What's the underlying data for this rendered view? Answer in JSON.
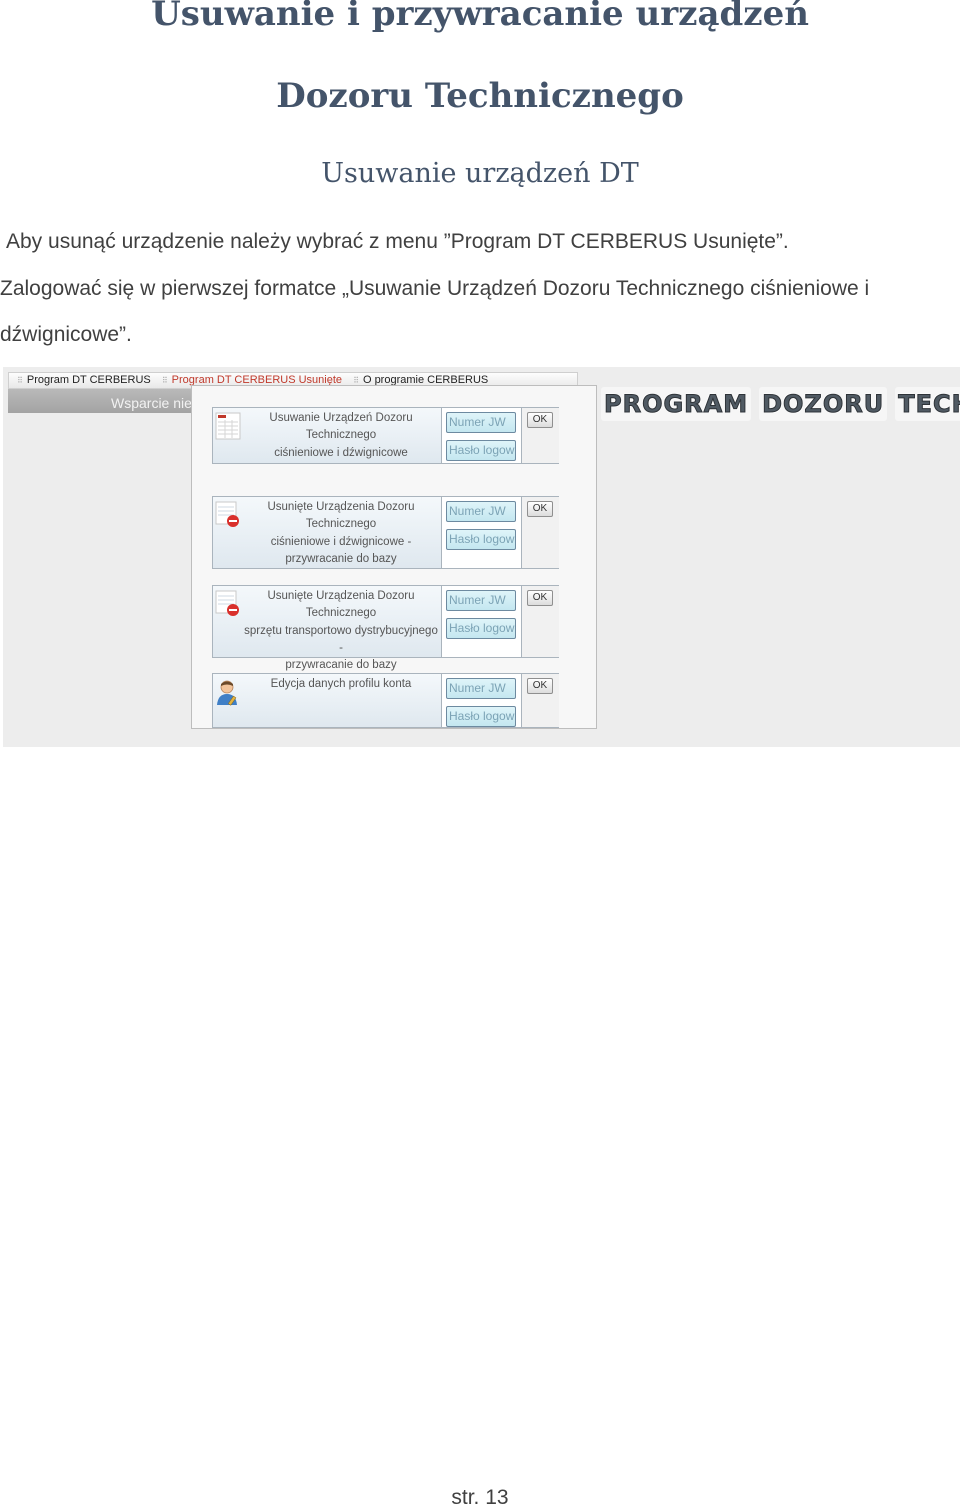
{
  "heading": {
    "line1": "Usuwanie i przywracanie  urządzeń",
    "line2": "Dozoru Technicznego",
    "subtitle": "Usuwanie urządzeń DT"
  },
  "paragraphs": {
    "p1": "Aby usunąć  urządzenie należy wybrać z menu ”Program DT CERBERUS Usunięte”.",
    "p2": "Zalogować się w pierwszej formatce „Usuwanie Urządzeń Dozoru Technicznego ciśnieniowe i",
    "p3": "dźwignicowe”."
  },
  "screenshot": {
    "menu": {
      "item1": "Program DT CERBERUS",
      "item2": "Program DT CERBERUS Usunięte",
      "item3": "O programie CERBERUS",
      "separator": "⠿"
    },
    "support_label": "Wsparcie nie",
    "forms": [
      {
        "lines": [
          "Usuwanie Urządzeń Dozoru",
          "Technicznego",
          "ciśnieniowe i dźwignicowe"
        ],
        "number_placeholder": "Numer JW",
        "password_placeholder": "Hasło logow",
        "ok_label": "OK"
      },
      {
        "lines": [
          "Usunięte Urządzenia Dozoru",
          "Technicznego",
          "ciśnieniowe i dźwignicowe -",
          "przywracanie do bazy"
        ],
        "number_placeholder": "Numer JW",
        "password_placeholder": "Hasło logow",
        "ok_label": "OK"
      },
      {
        "lines": [
          "Usunięte Urządzenia Dozoru",
          "Technicznego",
          "sprzętu transportowo dystrybucyjnego -",
          "przywracanie do bazy"
        ],
        "number_placeholder": "Numer JW",
        "password_placeholder": "Hasło logow",
        "ok_label": "OK"
      },
      {
        "lines": [
          "Edycja danych profilu konta"
        ],
        "number_placeholder": "Numer JW",
        "password_placeholder": "Hasło logow",
        "ok_label": "OK"
      }
    ],
    "banner": {
      "word1": "PROGRAM",
      "word2": "DOZORU",
      "word3": "TECH"
    },
    "icons": {
      "document": "document-delete-icon",
      "user": "user-edit-icon"
    }
  },
  "footer": {
    "page": "str. 13"
  }
}
